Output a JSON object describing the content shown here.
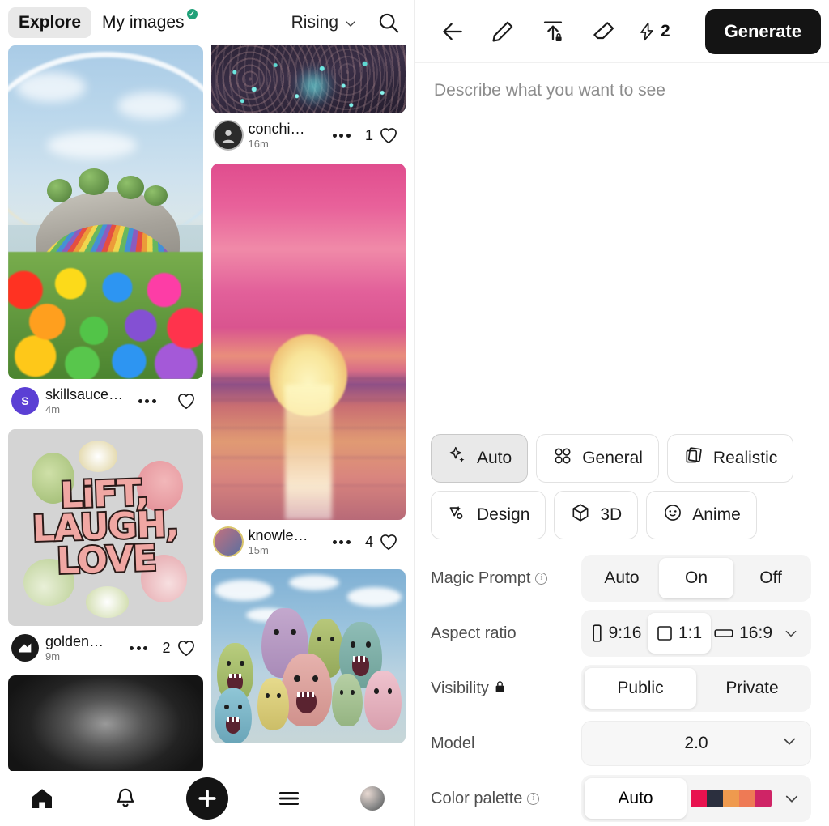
{
  "feed": {
    "tabs": [
      {
        "label": "Explore",
        "active": true,
        "badge": ""
      },
      {
        "label": "My images",
        "active": false,
        "badge": "✓"
      }
    ],
    "sort": {
      "label": "Rising",
      "icon": "chevron-down-icon"
    },
    "search_icon": "search-icon",
    "cards": [
      {
        "art": "rainbow",
        "user": "skillsauce…",
        "time": "4m",
        "likes": "",
        "avatar_letter": "S",
        "avatar_color": "#5b3fd4",
        "description": "Rainbow flower landscape with rocky island and rainbow path"
      },
      {
        "art": "quote",
        "user": "golden…",
        "time": "9m",
        "likes": "2",
        "avatar_letter": "",
        "avatar_color": "#1a1a1a",
        "quote_lines": [
          "LiFT,",
          "LAUGH,",
          "LOVE"
        ],
        "description": "Retro floral typography poster"
      },
      {
        "art": "dark",
        "user": "",
        "time": "",
        "likes": "",
        "description": "Dark gradient image, partially visible"
      },
      {
        "art": "crowd",
        "user": "conchi…",
        "time": "16m",
        "likes": "1",
        "avatar_letter": "",
        "avatar_color": "#2b2b2b",
        "description": "Dark concert crowd with teal lights, partially visible"
      },
      {
        "art": "sunset",
        "user": "knowle…",
        "time": "15m",
        "likes": "4",
        "avatar_letter": "",
        "avatar_color": "#b4607a",
        "avatar_ring": true,
        "description": "Pink sunset over ocean with sun reflection"
      },
      {
        "art": "monsters",
        "user": "",
        "time": "",
        "likes": "",
        "description": "Crowd of pastel cartoon monsters, partially visible"
      }
    ],
    "nav": [
      {
        "name": "home-icon",
        "label": "Home"
      },
      {
        "name": "bell-icon",
        "label": "Notifications"
      },
      {
        "name": "plus-icon",
        "label": "Create"
      },
      {
        "name": "menu-icon",
        "label": "Menu"
      },
      {
        "name": "profile-avatar",
        "label": "Profile"
      }
    ]
  },
  "generator": {
    "toolbar": {
      "back_icon": "back-arrow-icon",
      "edit_icon": "pencil-icon",
      "upload_icon": "upload-locked-icon",
      "erase_icon": "eraser-icon",
      "credits_icon": "lightning-bolt-icon",
      "credits": "2",
      "generate_label": "Generate"
    },
    "prompt": {
      "placeholder": "Describe what you want to see",
      "value": ""
    },
    "styles": [
      {
        "label": "Auto",
        "icon": "sparkle-icon",
        "selected": true
      },
      {
        "label": "General",
        "icon": "four-petal-icon",
        "selected": false
      },
      {
        "label": "Realistic",
        "icon": "photos-stack-icon",
        "selected": false
      },
      {
        "label": "Design",
        "icon": "design-icon",
        "selected": false
      },
      {
        "label": "3D",
        "icon": "cube-icon",
        "selected": false
      },
      {
        "label": "Anime",
        "icon": "anime-face-icon",
        "selected": false
      }
    ],
    "settings": {
      "magic_prompt": {
        "label": "Magic Prompt",
        "info": true,
        "options": [
          "Auto",
          "On",
          "Off"
        ],
        "selected": "On"
      },
      "aspect_ratio": {
        "label": "Aspect ratio",
        "options": [
          "9:16",
          "1:1",
          "16:9"
        ],
        "selected": "1:1",
        "chevron": "chevron-down-icon"
      },
      "visibility": {
        "label": "Visibility",
        "lock_icon": "lock-icon",
        "options": [
          "Public",
          "Private"
        ],
        "selected": "Public"
      },
      "model": {
        "label": "Model",
        "value": "2.0",
        "chevron": "chevron-down-icon"
      },
      "color_palette": {
        "label": "Color palette",
        "info": true,
        "value": "Auto",
        "swatch": [
          "#e8124f",
          "#2b2f3e",
          "#ef9a4e",
          "#ee7a55",
          "#cf2466"
        ],
        "chevron": "chevron-down-icon"
      }
    }
  },
  "colors": {
    "accent_dark": "#141414",
    "verified_green": "#21a179",
    "selected_chip_bg": "#e9e9e9"
  }
}
